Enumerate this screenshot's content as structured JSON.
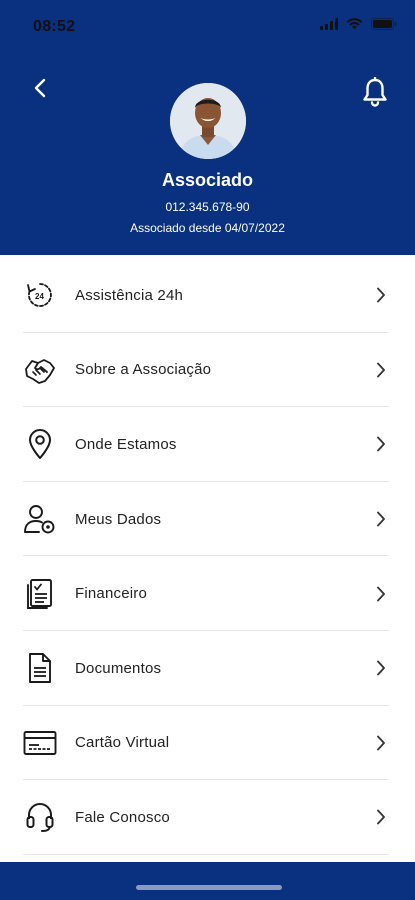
{
  "status_bar": {
    "time": "08:52"
  },
  "header": {
    "name": "Associado",
    "id_number": "012.345.678-90",
    "member_since": "Associado desde 04/07/2022",
    "colors": {
      "background": "#0a3180",
      "text": "#ffffff"
    }
  },
  "menu": {
    "items": [
      {
        "label": "Assistência 24h",
        "icon": "clock-24h-icon"
      },
      {
        "label": "Sobre a Associação",
        "icon": "handshake-icon"
      },
      {
        "label": "Onde Estamos",
        "icon": "location-pin-icon"
      },
      {
        "label": "Meus Dados",
        "icon": "user-settings-icon"
      },
      {
        "label": "Financeiro",
        "icon": "financial-checklist-icon"
      },
      {
        "label": "Documentos",
        "icon": "document-icon"
      },
      {
        "label": "Cartão Virtual",
        "icon": "card-icon"
      },
      {
        "label": "Fale Conosco",
        "icon": "headset-icon"
      }
    ]
  }
}
